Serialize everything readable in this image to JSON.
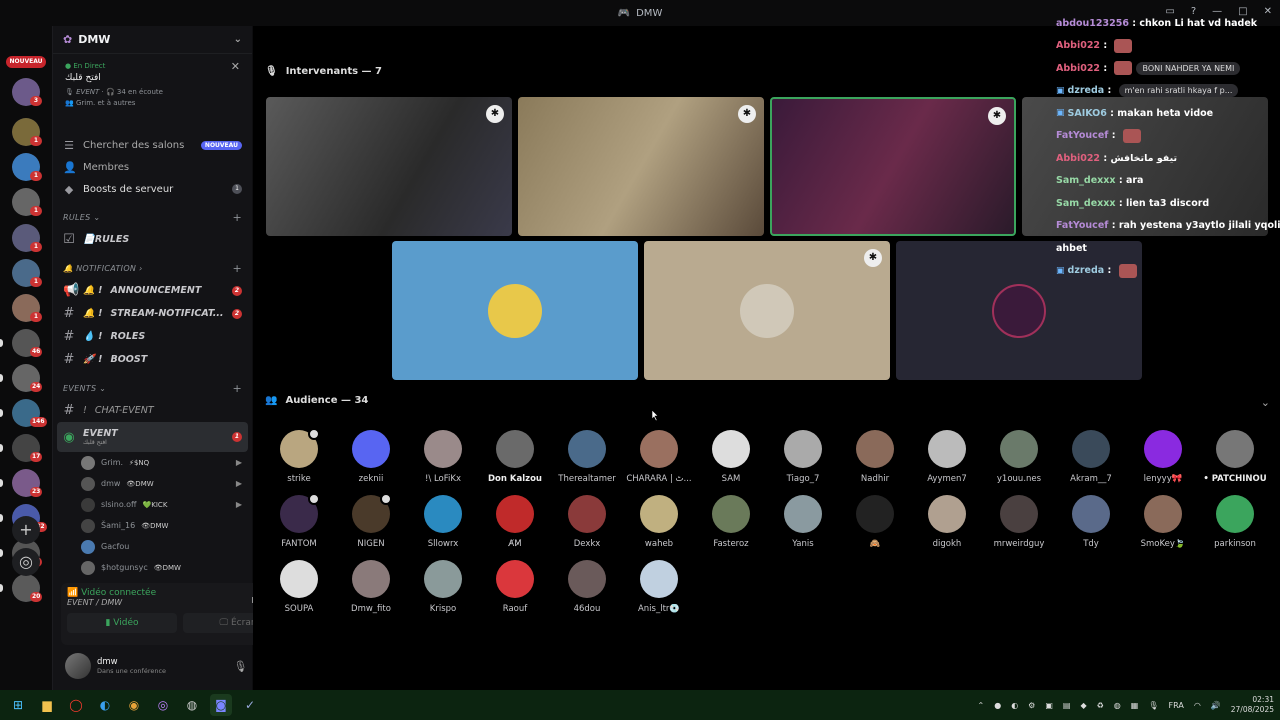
{
  "window": {
    "title": "DMW"
  },
  "rail": {
    "nouveau": "NOUVEAU",
    "servers": [
      {
        "badge": "3",
        "color": "#6c5a8a"
      },
      {
        "badge": "1",
        "color": "#7a6a3a"
      },
      {
        "badge": "1",
        "color": "#3b7bbd"
      },
      {
        "badge": "1",
        "color": "#666"
      },
      {
        "badge": "1",
        "color": "#5a5a7a"
      },
      {
        "badge": "1",
        "color": "#4a6a8a"
      },
      {
        "badge": "1",
        "color": "#8a6a5a"
      },
      {
        "badge": "46",
        "color": "#555"
      },
      {
        "badge": "24",
        "color": "#666"
      },
      {
        "badge": "146",
        "color": "#3a6a8a"
      },
      {
        "badge": "17",
        "color": "#444"
      },
      {
        "badge": "23",
        "color": "#7a5a8a"
      },
      {
        "badge": "132",
        "color": "#4a5aaa"
      },
      {
        "badge": "67",
        "color": "#555"
      },
      {
        "badge": "20",
        "color": "#5a5a5a"
      }
    ],
    "add_label": "+"
  },
  "sidebar": {
    "server_name": "DMW",
    "live": {
      "tag": "En Direct",
      "title": "افتح قلبك",
      "meta_event": "EVENT",
      "meta_listen": "34 en écoute",
      "meta_users": "Grim. et à autres"
    },
    "items": [
      {
        "label": "Chercher des salons",
        "badge": "NOUVEAU"
      },
      {
        "label": "Membres",
        "badge": ""
      },
      {
        "label": "Boosts de serveur",
        "badge": "1"
      }
    ],
    "categories": {
      "rules": "RULES",
      "notification": "NOTIFICATION",
      "events": "EVENTS"
    },
    "channels": {
      "rules": "📄RULES",
      "announcement": "ANNOUNCEMENT",
      "stream": "STREAM-NOTIFICAT...",
      "roles": "ROLES",
      "boost": "BOOST",
      "chat_event": "CHAT-EVENT",
      "event": "EVENT",
      "event_sub": "افتح قلبك"
    },
    "channel_badges": {
      "announcement": "2",
      "stream": "2",
      "event": "1"
    },
    "voice_members": [
      {
        "name": "Grim.",
        "tag": "⚡$NQ"
      },
      {
        "name": "dmw",
        "tag": "👁DMW"
      },
      {
        "name": "slsino.off",
        "tag": "💚KICK"
      },
      {
        "name": "Šami_16",
        "tag": "👁DMW"
      },
      {
        "name": "Gacfou",
        "tag": ""
      },
      {
        "name": "$hotgunsyc",
        "tag": "👁DMW"
      }
    ],
    "voice_panel": {
      "title": "Vidéo connectée",
      "sub": "EVENT / DMW",
      "video": "Vidéo",
      "screen": "Écran"
    },
    "user": {
      "name": "dmw",
      "status": "Dans une conférence"
    }
  },
  "stage": {
    "speakers_header": "Intervenants — 7",
    "audience_header": "Audience — 34"
  },
  "audience": [
    {
      "name": "strike",
      "color": "#b9a680"
    },
    {
      "name": "zeknii",
      "color": "#5865f2"
    },
    {
      "name": "!\\ LoFiKx",
      "color": "#9a8a8a"
    },
    {
      "name": "Don Kalzou",
      "color": "#6a6a6a"
    },
    {
      "name": "Therealtamer",
      "color": "#4a6a8a"
    },
    {
      "name": "CHARARA | ٹ...",
      "color": "#9a7060"
    },
    {
      "name": "SAM",
      "color": "#ddd"
    },
    {
      "name": "Tiago_7",
      "color": "#aaa"
    },
    {
      "name": "Nadhir",
      "color": "#8a6a5a"
    },
    {
      "name": "Ayymen7",
      "color": "#bbb"
    },
    {
      "name": "y1ouu.nes",
      "color": "#6a7a6a"
    },
    {
      "name": "Akram__7",
      "color": "#3a4a5a"
    },
    {
      "name": "lenyyy🎀",
      "color": "#8a2ae0"
    },
    {
      "name": "• PATCHINOU",
      "color": "#777"
    },
    {
      "name": "FANTOM",
      "color": "#3a2a4a"
    },
    {
      "name": "NIGEN",
      "color": "#4a3a2a"
    },
    {
      "name": "Sllowrx",
      "color": "#2a8ac0"
    },
    {
      "name": "A̸M̸",
      "color": "#c02a2a"
    },
    {
      "name": "Dexkx",
      "color": "#8a3a3a"
    },
    {
      "name": "waheb",
      "color": "#c0b080"
    },
    {
      "name": "Fasteroz",
      "color": "#6a7a5a"
    },
    {
      "name": "Yanis",
      "color": "#8a9aa0"
    },
    {
      "name": "🙈",
      "color": "#222"
    },
    {
      "name": "digokh",
      "color": "#b0a090"
    },
    {
      "name": "mrweirdguy",
      "color": "#4a4040"
    },
    {
      "name": "Tdy",
      "color": "#5a6a8a"
    },
    {
      "name": "SmoKey🍃",
      "color": "#8a6a5a"
    },
    {
      "name": "parkinson",
      "color": "#3ba55d"
    },
    {
      "name": "SOUPA",
      "color": "#ddd"
    },
    {
      "name": "Dmw_fito",
      "color": "#8a7a7a"
    },
    {
      "name": "Krispo",
      "color": "#8a9a9a"
    },
    {
      "name": "Raouf",
      "color": "#da373c"
    },
    {
      "name": "46dou",
      "color": "#6a5a5a"
    },
    {
      "name": "Anis_ltr💿",
      "color": "#c0d0e0"
    }
  ],
  "chat": [
    {
      "user": "abdou123256",
      "msg": "chkon Li hat vd hadek",
      "cls": ""
    },
    {
      "user": "Abbi022",
      "msg": "",
      "cls": "red",
      "img": true
    },
    {
      "user": "Abbi022",
      "msg": "",
      "cls": "red",
      "img": true,
      "pill": "BONI NAHDER YA NEMI"
    },
    {
      "user": "dzreda",
      "msg": "",
      "cls": "blue",
      "tw": true,
      "pill": "m'en rahi sratli hkaya f p..."
    },
    {
      "user": "SAIKO6",
      "msg": "makan heta vidoe",
      "cls": "blue",
      "tw": true
    },
    {
      "user": "FatYoucef",
      "msg": "",
      "cls": "",
      "img": true
    },
    {
      "user": "Abbi022",
      "msg": "تيفو ماتخافش",
      "cls": "red"
    },
    {
      "user": "Sam_dexxx",
      "msg": "ara",
      "cls": "green"
    },
    {
      "user": "Sam_dexxx",
      "msg": "lien ta3 discord",
      "cls": "green"
    },
    {
      "user": "FatYoucef",
      "msg": "rah yestena y3aytlo jilali yqoli",
      "cls": ""
    },
    {
      "user": "",
      "msg": "ahbet",
      "cls": ""
    },
    {
      "user": "dzreda",
      "msg": "",
      "cls": "blue",
      "tw": true,
      "img": true
    }
  ],
  "tray": {
    "lang": "FRA",
    "time": "02:31",
    "date": "27/08/2025"
  }
}
